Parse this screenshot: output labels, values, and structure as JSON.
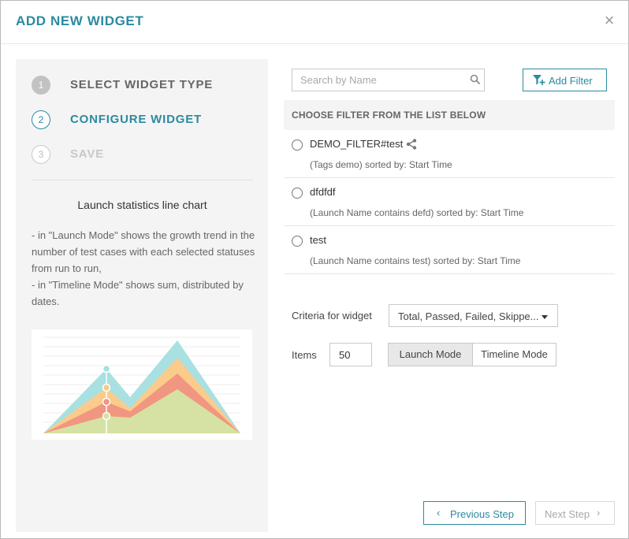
{
  "modal": {
    "title": "ADD NEW WIDGET"
  },
  "steps": [
    {
      "number": "1",
      "label": "SELECT WIDGET TYPE",
      "state": "done"
    },
    {
      "number": "2",
      "label": "CONFIGURE WIDGET",
      "state": "active"
    },
    {
      "number": "3",
      "label": "SAVE",
      "state": "future"
    }
  ],
  "widget": {
    "name": "Launch statistics line chart",
    "description": "- in \"Launch Mode\" shows the growth trend in the number of test cases with each selected statuses from run to run,\n- in \"Timeline Mode\" shows sum, distributed by dates."
  },
  "search": {
    "placeholder": "Search by Name",
    "value": ""
  },
  "add_filter": {
    "label": "Add Filter"
  },
  "filter_list": {
    "header": "CHOOSE FILTER FROM THE LIST BELOW",
    "items": [
      {
        "name": "DEMO_FILTER#test",
        "description": "(Tags demo) sorted by: Start Time",
        "shared": true
      },
      {
        "name": "dfdfdf",
        "description": "(Launch Name contains defd) sorted by: Start Time",
        "shared": false
      },
      {
        "name": "test",
        "description": "(Launch Name contains test) sorted by: Start Time",
        "shared": false
      }
    ]
  },
  "criteria": {
    "label": "Criteria for widget",
    "value": "Total, Passed, Failed, Skippe..."
  },
  "items_field": {
    "label": "Items",
    "value": "50"
  },
  "modes": {
    "launch": "Launch Mode",
    "timeline": "Timeline Mode",
    "selected": "launch"
  },
  "footer": {
    "previous": "Previous Step",
    "next": "Next Step"
  },
  "colors": {
    "accent": "#2b8aa0",
    "panel_bg": "#f4f4f4",
    "chart_total": "#a9e0e1",
    "chart_passed": "#fbcb8c",
    "chart_failed": "#f19680",
    "chart_skipped": "#d5e2a3"
  },
  "icons": {
    "close": "close-icon",
    "search": "search-icon",
    "add_filter": "filter-plus-icon",
    "share": "share-icon",
    "caret": "caret-down-icon",
    "prev": "chevron-left-icon",
    "next": "chevron-right-icon"
  }
}
